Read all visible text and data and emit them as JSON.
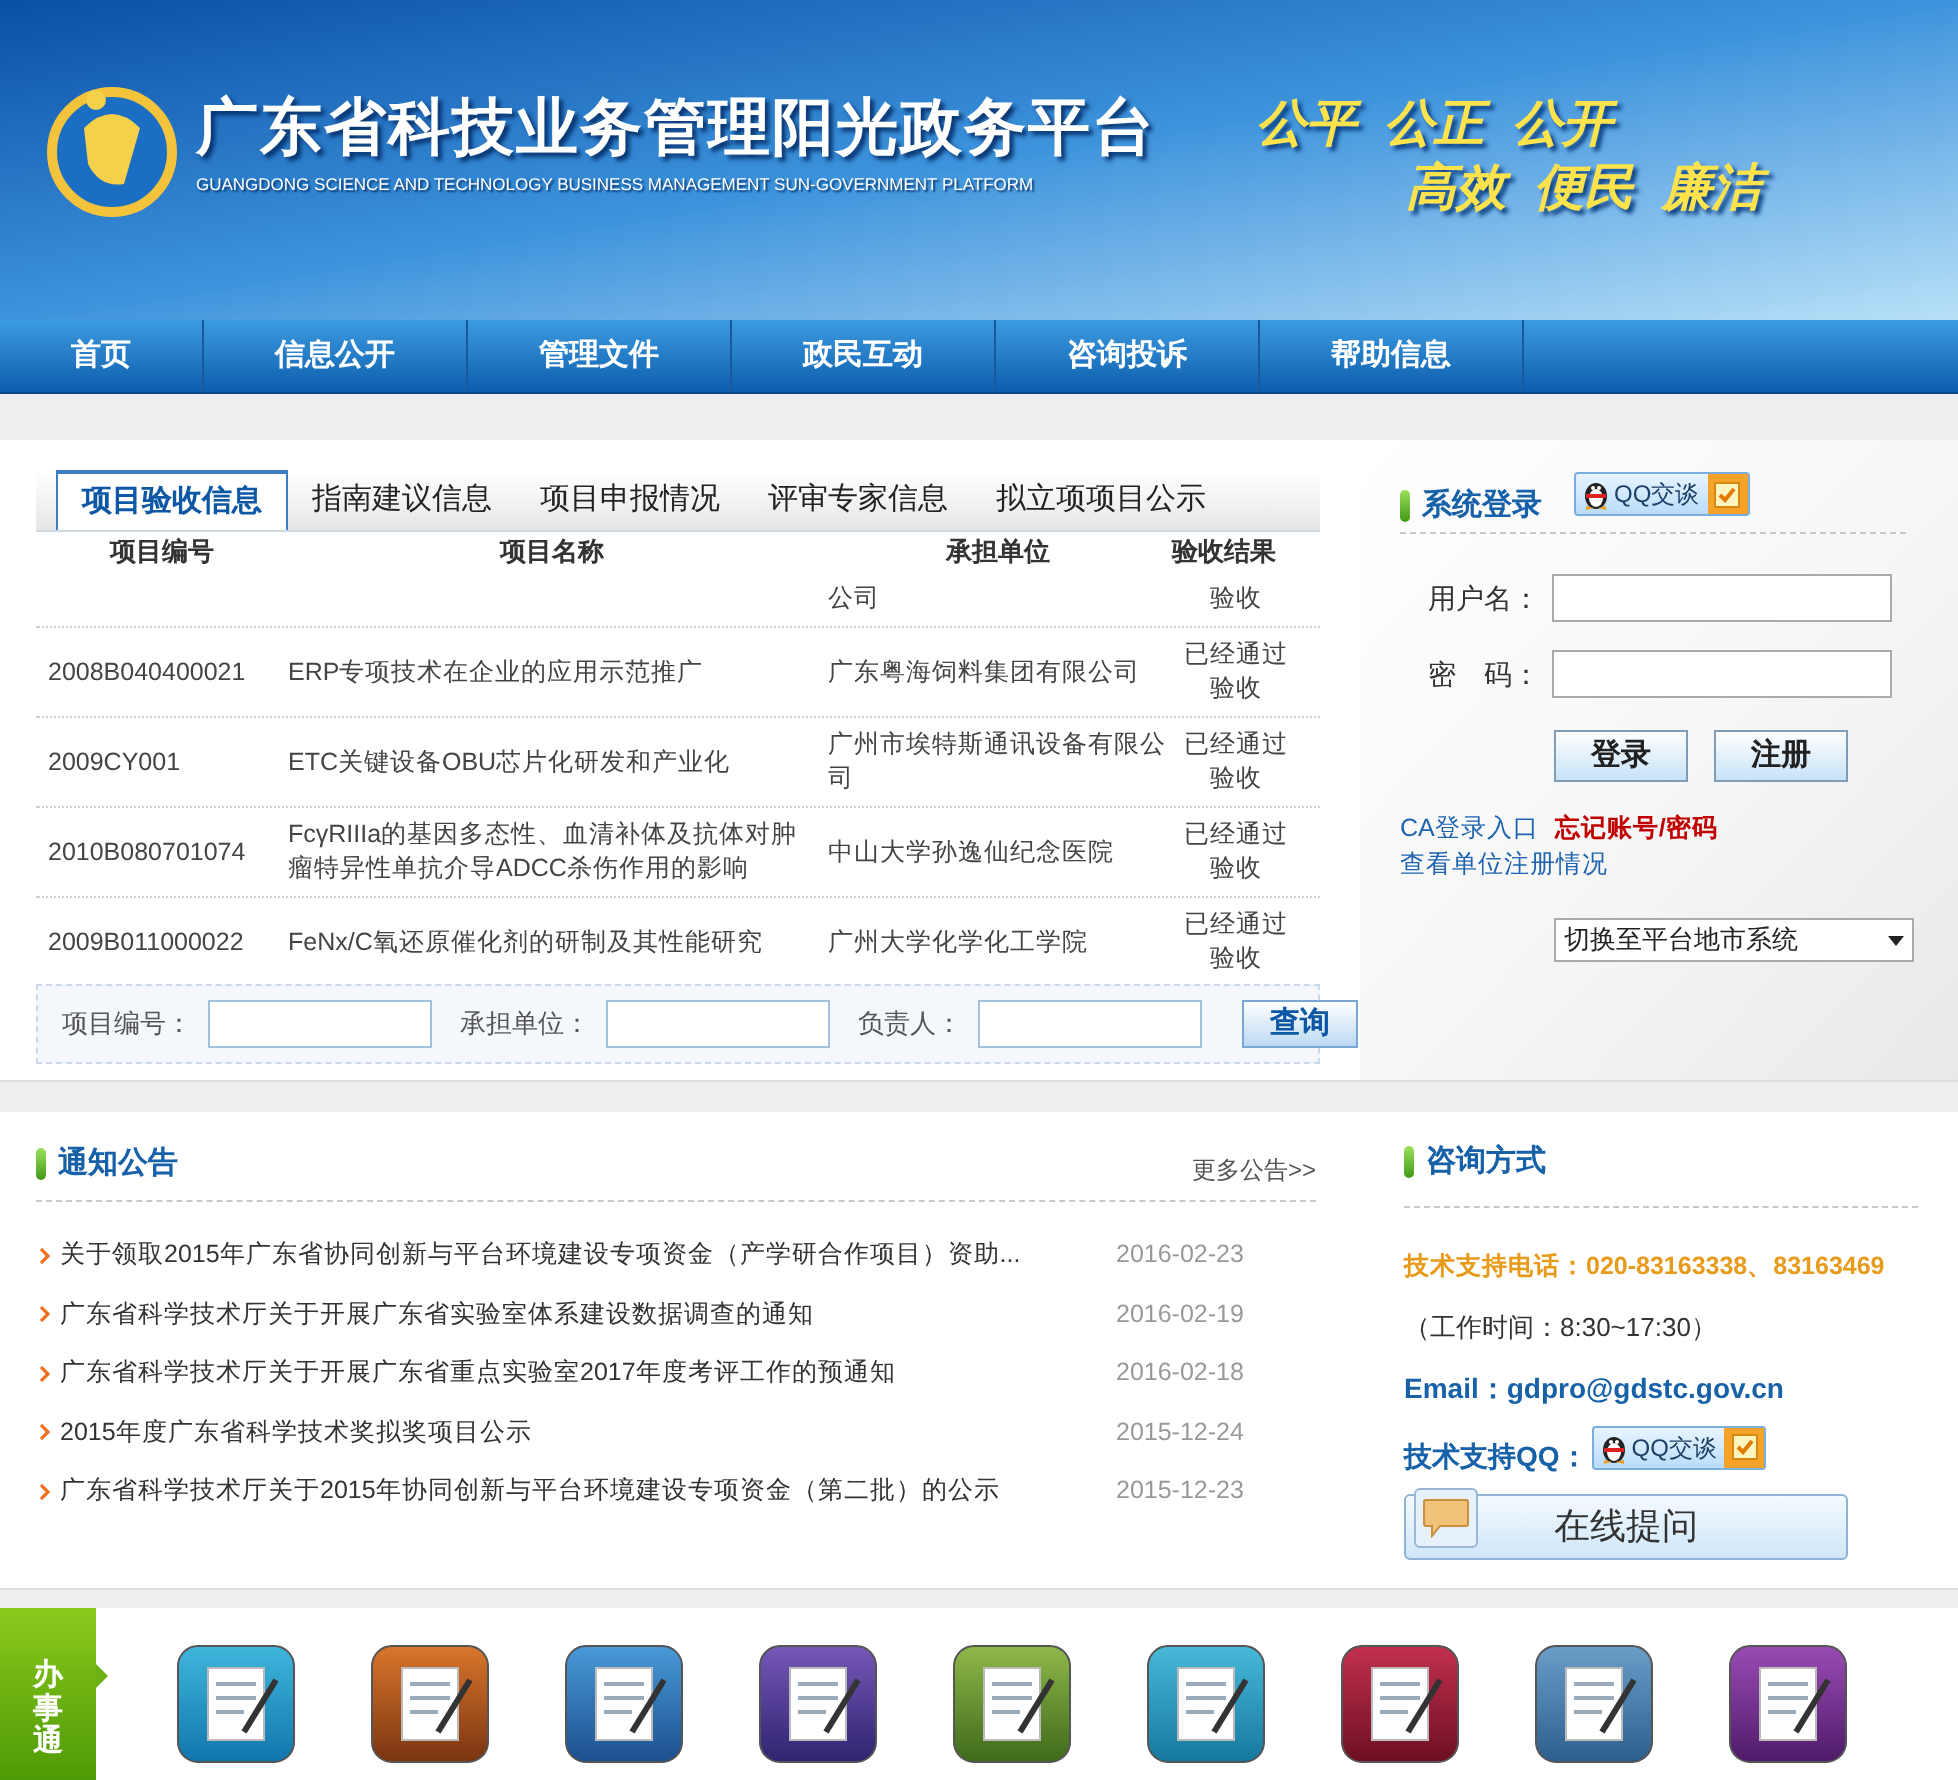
{
  "header": {
    "title": "广东省科技业务管理阳光政务平台",
    "subtitle": "GUANGDONG SCIENCE AND TECHNOLOGY BUSINESS MANAGEMENT SUN-GOVERNMENT PLATFORM",
    "slogans": [
      "公平 公正 公开",
      "高效 便民 廉洁"
    ]
  },
  "nav": [
    "首页",
    "信息公开",
    "管理文件",
    "政民互动",
    "咨询投诉",
    "帮助信息"
  ],
  "project_panel": {
    "tabs": [
      {
        "label": "项目验收信息",
        "selected": true
      },
      {
        "label": "指南建议信息",
        "selected": false
      },
      {
        "label": "项目申报情况",
        "selected": false
      },
      {
        "label": "评审专家信息",
        "selected": false
      },
      {
        "label": "拟立项项目公示",
        "selected": false
      }
    ],
    "columns": [
      "项目编号",
      "项目名称",
      "承担单位",
      "验收结果"
    ],
    "rows": [
      {
        "kind": "partial",
        "unit": "公司",
        "result": "验收"
      },
      {
        "kind": "full",
        "id": "2008B040400021",
        "name": "ERP专项技术在企业的应用示范推广",
        "unit": "广东粤海饲料集团有限公司",
        "result": "已经通过验收"
      },
      {
        "kind": "full",
        "id": "2009CY001",
        "name": "ETC关键设备OBU芯片化研发和产业化",
        "unit": "广州市埃特斯通讯设备有限公司",
        "result": "已经通过验收"
      },
      {
        "kind": "full",
        "id": "2010B080701074",
        "name": "FcγRIIIa的基因多态性、血清补体及抗体对肿瘤特异性单抗介导ADCC杀伤作用的影响",
        "unit": "中山大学孙逸仙纪念医院",
        "result": "已经通过验收"
      },
      {
        "kind": "full",
        "id": "2009B011000022",
        "name": "FeNx/C氧还原催化剂的研制及其性能研究",
        "unit": "广州大学化学化工学院",
        "result": "已经通过验收"
      }
    ],
    "search": {
      "fields": [
        "项目编号：",
        "承担单位：",
        "负责人："
      ],
      "button": "查询"
    }
  },
  "login": {
    "title": "系统登录",
    "qq_badge": "QQ交谈",
    "fields": [
      "用户名：",
      "密　码："
    ],
    "buttons": [
      "登录",
      "注册"
    ],
    "links": [
      {
        "text": "CA登录入口",
        "kind": "normal"
      },
      {
        "text": "忘记账号/密码",
        "kind": "alert"
      },
      {
        "text": "查看单位注册情况",
        "kind": "normal"
      }
    ],
    "system_select": "切换至平台地市系统"
  },
  "notices": {
    "title": "通知公告",
    "more": "更多公告>>",
    "items": [
      {
        "text": "关于领取2015年广东省协同创新与平台环境建设专项资金（产学研合作项目）资助...",
        "date": "2016-02-23"
      },
      {
        "text": "广东省科学技术厅关于开展广东省实验室体系建设数据调查的通知",
        "date": "2016-02-19"
      },
      {
        "text": "广东省科学技术厅关于开展广东省重点实验室2017年度考评工作的预通知",
        "date": "2016-02-18"
      },
      {
        "text": "2015年度广东省科学技术奖拟奖项目公示",
        "date": "2015-12-24"
      },
      {
        "text": "广东省科学技术厅关于2015年协同创新与平台环境建设专项资金（第二批）的公示",
        "date": "2015-12-23"
      }
    ]
  },
  "contact": {
    "title": "咨询方式",
    "phone": "技术支持电话：020-83163338、83163469",
    "hours": "（工作时间：8:30~17:30）",
    "email": "Email：gdpro@gdstc.gov.cn",
    "qq_label": "技术支持QQ：",
    "qq_badge": "QQ交谈",
    "ask_button": "在线提问"
  },
  "shortcut_bar": {
    "label": "办事通"
  }
}
